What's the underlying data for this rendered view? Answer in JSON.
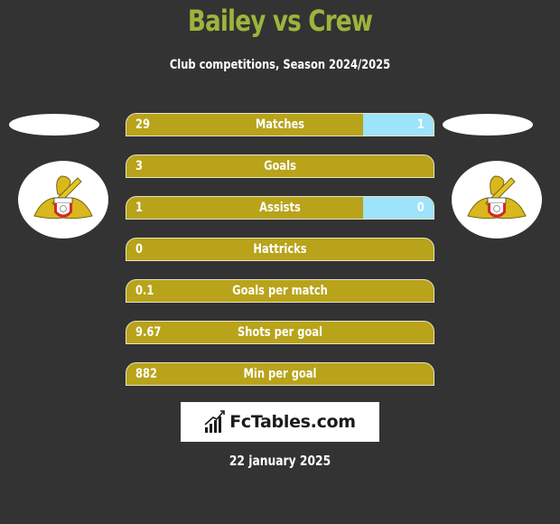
{
  "header": {
    "title": "Bailey vs Crew",
    "subtitle": "Club competitions, Season 2024/2025"
  },
  "teams": {
    "left": {
      "name": "Bailey",
      "logo_icon": "doncaster-rovers-crest-icon"
    },
    "right": {
      "name": "Crew",
      "logo_icon": "doncaster-rovers-crest-icon"
    }
  },
  "colors": {
    "background": "#333333",
    "title": "#9bb53c",
    "left_bar": "#b8a31a",
    "right_bar": "#9de3f9"
  },
  "stats": [
    {
      "label": "Matches",
      "left": "29",
      "right": "1",
      "right_share": 0.23
    },
    {
      "label": "Goals",
      "left": "3",
      "right": "",
      "right_share": 0
    },
    {
      "label": "Assists",
      "left": "1",
      "right": "0",
      "right_share": 0.23
    },
    {
      "label": "Hattricks",
      "left": "0",
      "right": "",
      "right_share": 0
    },
    {
      "label": "Goals per match",
      "left": "0.1",
      "right": "",
      "right_share": 0
    },
    {
      "label": "Shots per goal",
      "left": "9.67",
      "right": "",
      "right_share": 0
    },
    {
      "label": "Min per goal",
      "left": "882",
      "right": "",
      "right_share": 0
    }
  ],
  "brand": {
    "name": "FcTables.com",
    "icon": "bar-chart-icon"
  },
  "footer": {
    "date": "22 january 2025"
  }
}
